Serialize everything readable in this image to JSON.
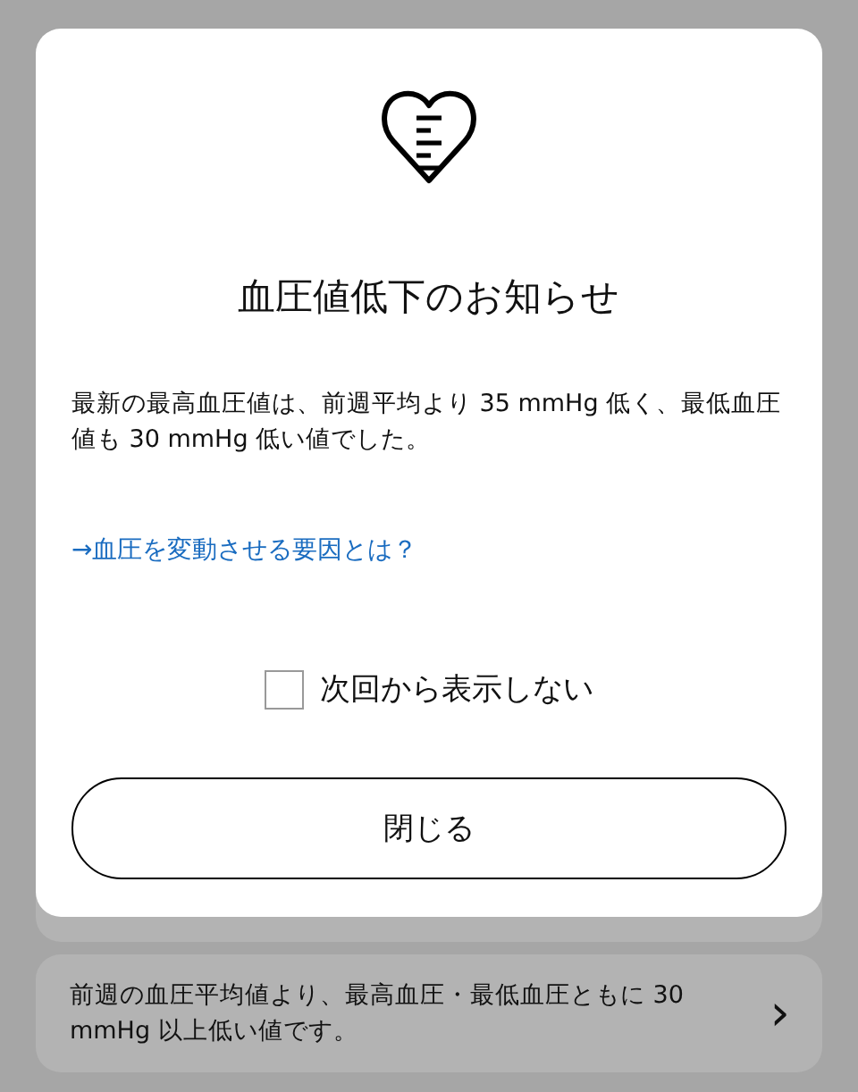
{
  "dialog": {
    "title": "血圧値低下のお知らせ",
    "message": "最新の最高血圧値は、前週平均より 35 mmHg 低く、最低血圧値も 30 mmHg 低い値でした。",
    "link": "→血圧を変動させる要因とは？",
    "checkbox": {
      "label": "次回から表示しない",
      "checked": false
    },
    "close_button": "閉じる"
  },
  "background_card": {
    "text": "前週の血圧平均値より、最高血圧・最低血圧ともに 30 mmHg 以上低い値です。",
    "chevron": "›"
  }
}
